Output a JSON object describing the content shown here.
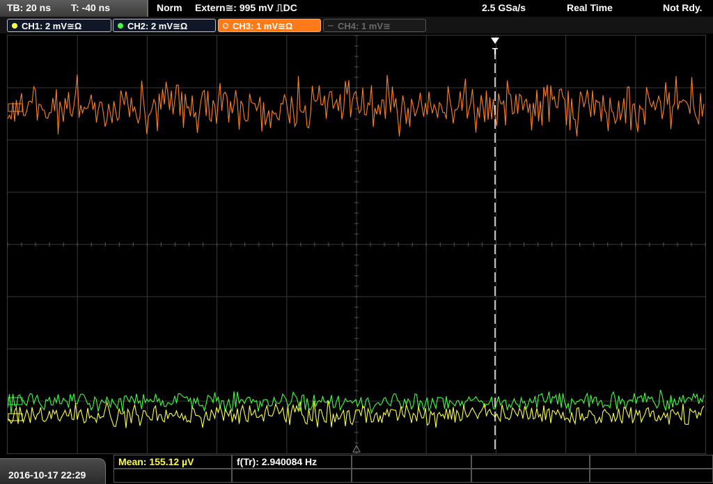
{
  "topbar": {
    "timebase": "TB: 20 ns",
    "trigger_time": "T: -40 ns",
    "mode": "Norm",
    "trigger_source": "Extern≅: 995 mV ⎍DC",
    "sample_rate": "2.5 GSa/s",
    "acquisition": "Real Time",
    "status": "Not Rdy."
  },
  "channels": [
    {
      "label": "CH1: 2 mV≅Ω",
      "color": "#ffff40",
      "state": "on"
    },
    {
      "label": "CH2: 2 mV≅Ω",
      "color": "#40ff40",
      "state": "on"
    },
    {
      "label": "CH3: 1 mV≅Ω",
      "color": "#ff8020",
      "state": "active"
    },
    {
      "label": "CH4: 1 mV≅",
      "color": "#606060",
      "state": "off"
    }
  ],
  "trigger_marker": "T",
  "bottom": {
    "datetime": "2016-10-17 22:29",
    "mean": "Mean: 155.12 µV",
    "frequency": "f(Tr): 2.940084 Hz"
  },
  "colors": {
    "ch1": "#ffff40",
    "ch2": "#40ff40",
    "ch3": "#ff8020",
    "grid": "#3a3a3a",
    "mean_text": "#ffff40"
  }
}
